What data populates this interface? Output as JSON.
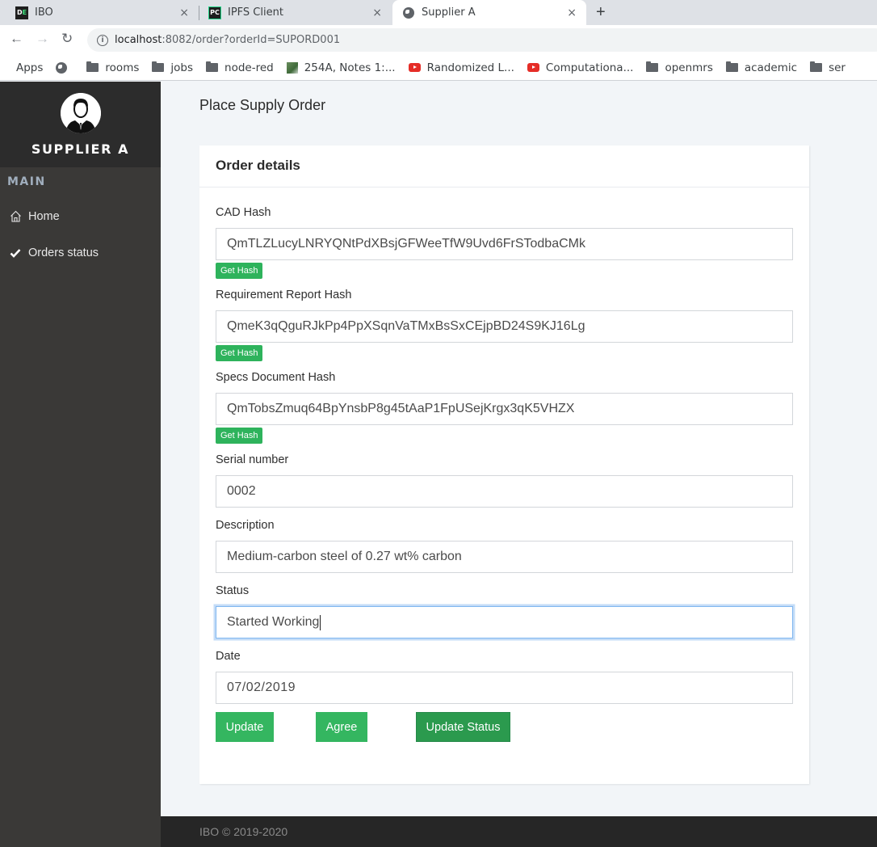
{
  "browser": {
    "tabs": [
      {
        "label": "IBO",
        "favicon": "DE",
        "active": false
      },
      {
        "label": "IPFS Client",
        "favicon": "PC",
        "active": false
      },
      {
        "label": "Supplier A",
        "favicon": "globe-icon",
        "active": true
      }
    ],
    "new_tab_label": "+",
    "close_label": "×",
    "url_host": "localhost",
    "url_path": ":8082/order?orderId=SUPORD001",
    "bookmarks": [
      {
        "label": "Apps",
        "icon": "apps-grid-icon"
      },
      {
        "label": "",
        "icon": "globe-icon"
      },
      {
        "label": "rooms",
        "icon": "folder-icon"
      },
      {
        "label": "jobs",
        "icon": "folder-icon"
      },
      {
        "label": "node-red",
        "icon": "folder-icon"
      },
      {
        "label": "254A, Notes 1:...",
        "icon": "image-icon"
      },
      {
        "label": "Randomized L...",
        "icon": "youtube-icon"
      },
      {
        "label": "Computationa...",
        "icon": "youtube-icon"
      },
      {
        "label": "openmrs",
        "icon": "folder-icon"
      },
      {
        "label": "academic",
        "icon": "folder-icon"
      },
      {
        "label": "ser",
        "icon": "folder-icon"
      }
    ]
  },
  "sidebar": {
    "brand": "SUPPLIER A",
    "section": "MAIN",
    "items": [
      {
        "label": "Home",
        "icon": "home-icon"
      },
      {
        "label": "Orders status",
        "icon": "check-icon"
      }
    ]
  },
  "page": {
    "title": "Place Supply Order",
    "card_title": "Order details",
    "get_hash_label": "Get Hash",
    "fields": {
      "cad_hash": {
        "label": "CAD Hash",
        "value": "QmTLZLucyLNRYQNtPdXBsjGFWeeTfW9Uvd6FrSTodbaCMk"
      },
      "requirement_hash": {
        "label": "Requirement Report Hash",
        "value": "QmeK3qQguRJkPp4PpXSqnVaTMxBsSxCEjpBD24S9KJ16Lg"
      },
      "specs_hash": {
        "label": "Specs Document Hash",
        "value": "QmTobsZmuq64BpYnsbP8g45tAaP1FpUSejKrgx3qK5VHZX"
      },
      "serial": {
        "label": "Serial number",
        "value": "0002"
      },
      "description": {
        "label": "Description",
        "value": "Medium-carbon steel of 0.27 wt% carbon"
      },
      "status": {
        "label": "Status",
        "value": "Started Working"
      },
      "date": {
        "label": "Date",
        "value": "07/02/2019"
      }
    },
    "buttons": {
      "update": "Update",
      "agree": "Agree",
      "update_status": "Update Status"
    }
  },
  "footer": {
    "text": "IBO © 2019-2020"
  },
  "colors": {
    "accent_green": "#34b660",
    "dark_green": "#2b9a4e",
    "sidebar_bg": "#3a3937",
    "sidebar_head_bg": "#2c2c2c",
    "footer_bg": "#262626"
  }
}
